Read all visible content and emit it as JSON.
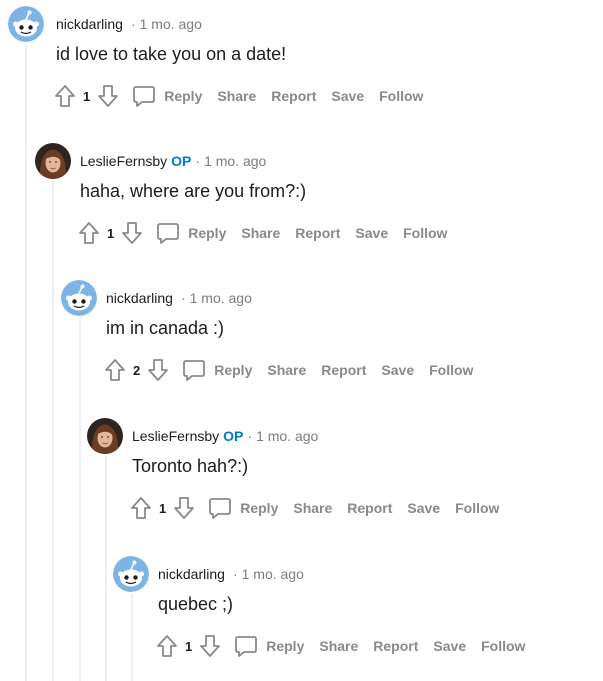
{
  "comments": [
    {
      "username": "nickdarling",
      "op_badge": "",
      "separator": "·",
      "time": "1 mo. ago",
      "body": "id love to take you on a date!",
      "score": "1",
      "avatar": "snoo-avatar-icon",
      "actions": {
        "reply": "Reply",
        "share": "Share",
        "report": "Report",
        "save": "Save",
        "follow": "Follow"
      }
    },
    {
      "username": "LeslieFernsby",
      "op_badge": "OP",
      "separator": "·",
      "time": "1 mo. ago",
      "body": "haha, where are you from?:)",
      "score": "1",
      "avatar": "user-photo-avatar",
      "actions": {
        "reply": "Reply",
        "share": "Share",
        "report": "Report",
        "save": "Save",
        "follow": "Follow"
      }
    },
    {
      "username": "nickdarling",
      "op_badge": "",
      "separator": "·",
      "time": "1 mo. ago",
      "body": "im in canada :)",
      "score": "2",
      "avatar": "snoo-avatar-icon",
      "actions": {
        "reply": "Reply",
        "share": "Share",
        "report": "Report",
        "save": "Save",
        "follow": "Follow"
      }
    },
    {
      "username": "LeslieFernsby",
      "op_badge": "OP",
      "separator": "·",
      "time": "1 mo. ago",
      "body": "Toronto hah?:)",
      "score": "1",
      "avatar": "user-photo-avatar",
      "actions": {
        "reply": "Reply",
        "share": "Share",
        "report": "Report",
        "save": "Save",
        "follow": "Follow"
      }
    },
    {
      "username": "nickdarling",
      "op_badge": "",
      "separator": "·",
      "time": "1 mo. ago",
      "body": "quebec ;)",
      "score": "1",
      "avatar": "snoo-avatar-icon",
      "actions": {
        "reply": "Reply",
        "share": "Share",
        "report": "Report",
        "save": "Save",
        "follow": "Follow"
      }
    }
  ],
  "colors": {
    "op_badge": "#0079d3",
    "meta_gray": "#7c7c7c",
    "action_gray": "#878a8c",
    "thread_line": "#edeff1",
    "snoo_blue": "#7eb3e6"
  }
}
